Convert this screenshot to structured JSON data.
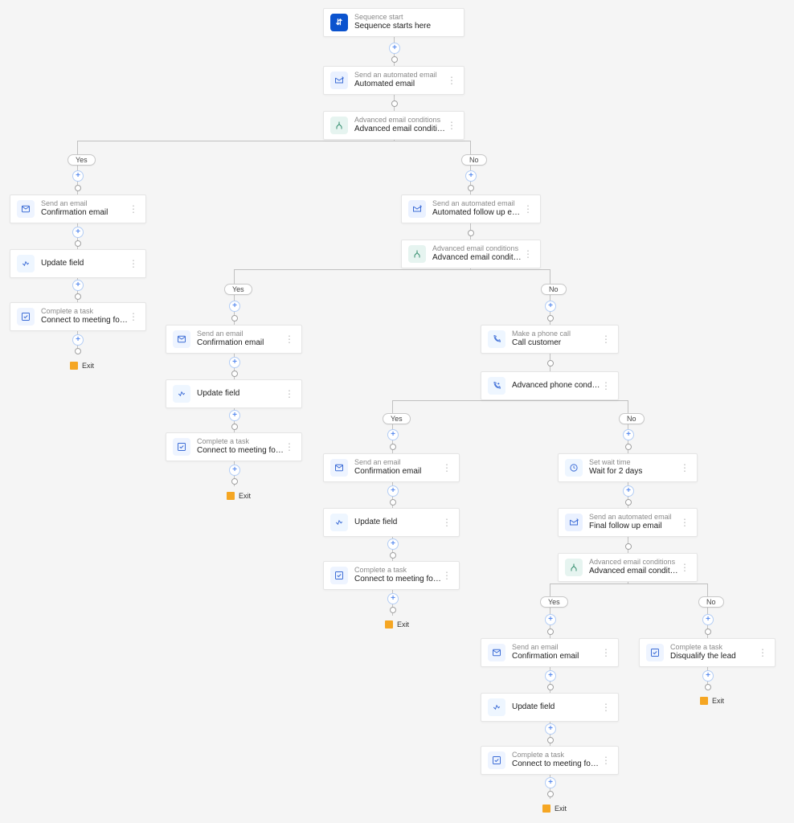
{
  "nodes": {
    "start": {
      "sub": "Sequence start",
      "title": "Sequence starts here"
    },
    "auto1": {
      "sub": "Send an automated email",
      "title": "Automated email"
    },
    "cond1": {
      "sub": "Advanced email conditions",
      "title": "Advanced email conditions"
    },
    "email_A": {
      "sub": "Send an email",
      "title": "Confirmation email"
    },
    "update_A": {
      "title": "Update field"
    },
    "task_A": {
      "sub": "Complete a task",
      "title": "Connect to meeting for product demo r…"
    },
    "auto2": {
      "sub": "Send an automated email",
      "title": "Automated follow up email"
    },
    "cond2": {
      "sub": "Advanced email conditions",
      "title": "Advanced email conditions"
    },
    "email_B": {
      "sub": "Send an email",
      "title": "Confirmation email"
    },
    "update_B": {
      "title": "Update field"
    },
    "task_B": {
      "sub": "Complete a task",
      "title": "Connect to meeting for product demo r…"
    },
    "phone": {
      "sub": "Make a phone call",
      "title": "Call customer"
    },
    "phonecond": {
      "title": "Advanced phone condition"
    },
    "email_C": {
      "sub": "Send an email",
      "title": "Confirmation email"
    },
    "update_C": {
      "title": "Update field"
    },
    "task_C": {
      "sub": "Complete a task",
      "title": "Connect to meeting for product demo r…"
    },
    "wait": {
      "sub": "Set wait time",
      "title": "Wait for 2 days"
    },
    "auto3": {
      "sub": "Send an automated email",
      "title": "Final follow up email"
    },
    "cond3": {
      "sub": "Advanced email conditions",
      "title": "Advanced email conditions"
    },
    "email_D": {
      "sub": "Send an email",
      "title": "Confirmation email"
    },
    "update_D": {
      "title": "Update field"
    },
    "task_D": {
      "sub": "Complete a task",
      "title": "Connect to meeting for product demo r…"
    },
    "task_E": {
      "sub": "Complete a task",
      "title": "Disqualify the lead"
    }
  },
  "labels": {
    "yes": "Yes",
    "no": "No",
    "exit": "Exit"
  }
}
